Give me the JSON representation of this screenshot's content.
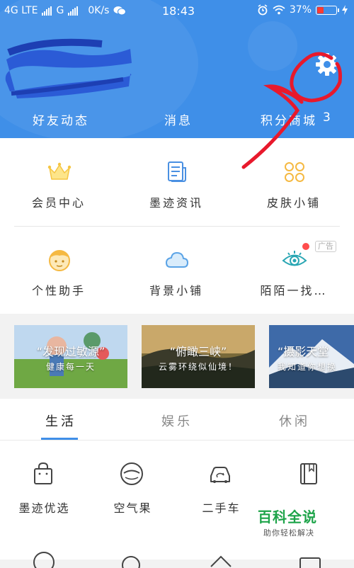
{
  "status_bar": {
    "network": "4G LTE",
    "network2": "G",
    "speed": "0K/s",
    "time": "18:43",
    "battery": "37%",
    "battery_level": 0.37
  },
  "header": {
    "tabs": [
      {
        "label": "好友动态"
      },
      {
        "label": "消息"
      },
      {
        "label": "积分商城"
      },
      {
        "label": "3"
      }
    ]
  },
  "grid": [
    {
      "label": "会员中心",
      "icon": "crown-icon"
    },
    {
      "label": "墨迹资讯",
      "icon": "news-icon"
    },
    {
      "label": "皮肤小铺",
      "icon": "clover-icon"
    },
    {
      "label": "个性助手",
      "icon": "assistant-icon"
    },
    {
      "label": "背景小铺",
      "icon": "cloud-icon"
    },
    {
      "label": "陌陌一找…",
      "icon": "eye-icon",
      "badge": "广告"
    }
  ],
  "banners": [
    {
      "title": "“发现过敏源”",
      "subtitle": "健康每一天"
    },
    {
      "title": "“俯瞰三峡”",
      "subtitle": "云雾环绕似仙境！"
    },
    {
      "title": "“摄影天堂",
      "subtitle": "我知道你想换"
    }
  ],
  "category_tabs": [
    {
      "label": "生活",
      "active": true
    },
    {
      "label": "娱乐",
      "active": false
    },
    {
      "label": "休闲",
      "active": false
    }
  ],
  "apps": [
    {
      "label": "墨迹优选",
      "icon": "shopping-bag-icon"
    },
    {
      "label": "空气果",
      "icon": "air-fruit-icon"
    },
    {
      "label": "二手车",
      "icon": "car-icon"
    },
    {
      "label": "",
      "icon": "book-icon"
    }
  ],
  "watermark": {
    "title": "百科全说",
    "subtitle": "助你轻松解决"
  },
  "colors": {
    "header": "#3f8fe8",
    "red": "#e8192c"
  }
}
